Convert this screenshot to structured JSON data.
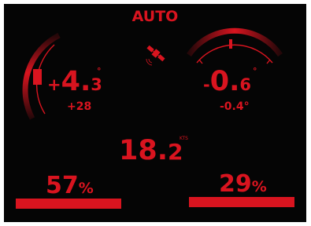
{
  "mode": "AUTO",
  "left_gauge": {
    "sign": "+",
    "integer": "4.",
    "decimal": "3",
    "degree": "°",
    "sub_value": "+28"
  },
  "right_gauge": {
    "sign": "-",
    "integer": "0.",
    "decimal": "6",
    "degree": "°",
    "sub_value": "-0.4°"
  },
  "speed": {
    "integer": "18.",
    "decimal": "2",
    "unit": "KTS"
  },
  "left_percent": {
    "value": "57",
    "unit": "%",
    "level": 57
  },
  "right_percent": {
    "value": "29",
    "unit": "%",
    "level": 29
  },
  "icons": {
    "gps": "satellite-icon"
  },
  "colors": {
    "accent": "#d9141f",
    "background": "#050505"
  }
}
